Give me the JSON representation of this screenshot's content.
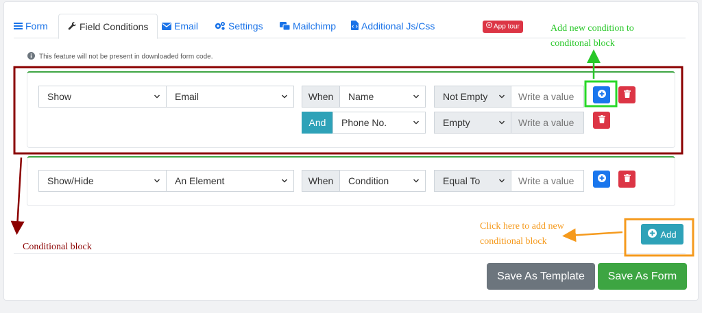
{
  "tabs": [
    {
      "label": "Form",
      "icon": "list-icon"
    },
    {
      "label": "Field Conditions",
      "icon": "wrench-icon",
      "active": true
    },
    {
      "label": "Email",
      "icon": "envelope-icon"
    },
    {
      "label": "Settings",
      "icon": "gears-icon"
    },
    {
      "label": "Mailchimp",
      "icon": "mailchimp-icon"
    },
    {
      "label": "Additional Js/Css",
      "icon": "code-file-icon"
    }
  ],
  "app_tour": "App tour",
  "notice": "This feature will not be present in downloaded form code.",
  "block1": {
    "action": "Show",
    "target": "Email",
    "rows": [
      {
        "connector": "When",
        "field": "Name",
        "operator": "Not Empty",
        "value_placeholder": "Write a value"
      },
      {
        "connector": "And",
        "field": "Phone No.",
        "operator": "Empty",
        "value_placeholder": "Write a value"
      }
    ]
  },
  "block2": {
    "action": "Show/Hide",
    "target": "An Element",
    "rows": [
      {
        "connector": "When",
        "field": "Condition",
        "operator": "Equal To",
        "value_placeholder": "Write a value"
      }
    ]
  },
  "add_button": "Add",
  "save_template": "Save As Template",
  "save_form": "Save As Form",
  "annotations": {
    "add_condition_line1": "Add new condition to",
    "add_condition_line2": "conditonal block",
    "add_block_line1": "Click here to add new",
    "add_block_line2": "conditional block",
    "conditional_block": "Conditional block"
  },
  "colors": {
    "link_blue": "#1a73e8",
    "teal": "#2ea2b8",
    "danger": "#dc3545",
    "success": "#3da542",
    "annotation_green": "#28c728",
    "annotation_orange": "#f59a1d",
    "annotation_maroon": "#8b0000"
  }
}
